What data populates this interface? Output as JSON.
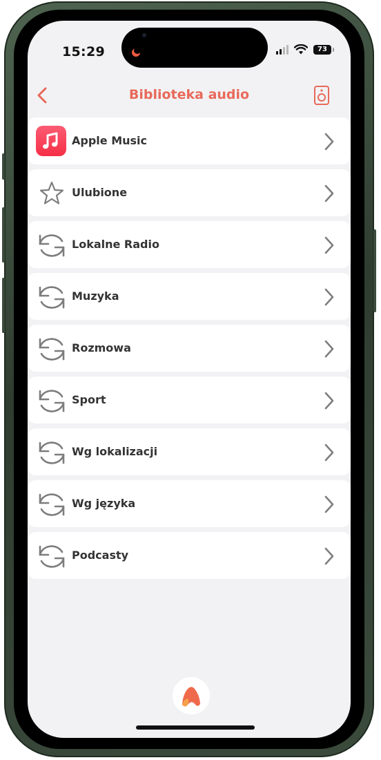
{
  "status_bar": {
    "time": "15:29",
    "battery": "73",
    "signal_bars": 4,
    "signal_active_bars": 2
  },
  "header": {
    "title": "Biblioteka audio",
    "back_icon": "chevron-left-icon",
    "speaker_icon": "speaker-icon"
  },
  "colors": {
    "accent": "#e8695a",
    "apple_music": "#f53b52",
    "icon_gray": "#7d7d7d",
    "background": "#f2f2f4",
    "row_background": "#ffffff"
  },
  "menu": {
    "items": [
      {
        "label": "Apple Music",
        "icon": "apple-music-icon"
      },
      {
        "label": "Ulubione",
        "icon": "star-icon"
      },
      {
        "label": "Lokalne Radio",
        "icon": "refresh-icon"
      },
      {
        "label": "Muzyka",
        "icon": "refresh-icon"
      },
      {
        "label": "Rozmowa",
        "icon": "refresh-icon"
      },
      {
        "label": "Sport",
        "icon": "refresh-icon"
      },
      {
        "label": "Wg lokalizacji",
        "icon": "refresh-icon"
      },
      {
        "label": "Wg języka",
        "icon": "refresh-icon"
      },
      {
        "label": "Podcasty",
        "icon": "refresh-icon"
      }
    ]
  },
  "footer": {
    "logo_icon": "app-logo-icon"
  }
}
